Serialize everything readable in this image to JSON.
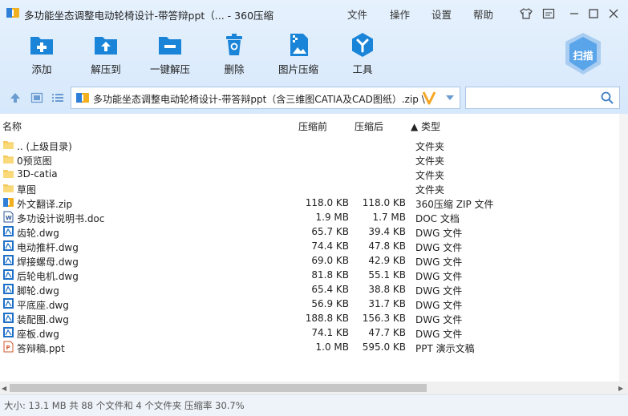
{
  "window": {
    "title": "多功能坐态调整电动轮椅设计-带答辩ppt（...  - 360压缩",
    "menu": [
      "文件",
      "操作",
      "设置",
      "帮助"
    ]
  },
  "toolbar": {
    "add": "添加",
    "extract": "解压到",
    "one_click": "一键解压",
    "delete": "删除",
    "image_compress": "图片压缩",
    "tools": "工具",
    "scan": "扫描"
  },
  "address": {
    "path": "多功能坐态调整电动轮椅设计-带答辩ppt（含三维图CATIA及CAD图纸）.zip \\",
    "search_placeholder": ""
  },
  "columns": {
    "name": "名称",
    "size": "压缩前",
    "packed": "压缩后",
    "type": "▲ 类型"
  },
  "files": [
    {
      "name": ".. (上级目录)",
      "size": "",
      "packed": "",
      "type": "文件夹",
      "icon": "folder-icon"
    },
    {
      "name": "0预览图",
      "size": "",
      "packed": "",
      "type": "文件夹",
      "icon": "folder-icon"
    },
    {
      "name": "3D-catia",
      "size": "",
      "packed": "",
      "type": "文件夹",
      "icon": "folder-icon"
    },
    {
      "name": "草图",
      "size": "",
      "packed": "",
      "type": "文件夹",
      "icon": "folder-icon"
    },
    {
      "name": "外文翻译.zip",
      "size": "118.0 KB",
      "packed": "118.0 KB",
      "type": "360压缩 ZIP 文件",
      "icon": "zip-icon"
    },
    {
      "name": "多功设计说明书.doc",
      "size": "1.9 MB",
      "packed": "1.7 MB",
      "type": "DOC 文档",
      "icon": "doc-icon"
    },
    {
      "name": "齿轮.dwg",
      "size": "65.7 KB",
      "packed": "39.4 KB",
      "type": "DWG 文件",
      "icon": "dwg-icon"
    },
    {
      "name": "电动推杆.dwg",
      "size": "74.4 KB",
      "packed": "47.8 KB",
      "type": "DWG 文件",
      "icon": "dwg-icon"
    },
    {
      "name": "焊接螺母.dwg",
      "size": "69.0 KB",
      "packed": "42.9 KB",
      "type": "DWG 文件",
      "icon": "dwg-icon"
    },
    {
      "name": "后轮电机.dwg",
      "size": "81.8 KB",
      "packed": "55.1 KB",
      "type": "DWG 文件",
      "icon": "dwg-icon"
    },
    {
      "name": "脚轮.dwg",
      "size": "65.4 KB",
      "packed": "38.8 KB",
      "type": "DWG 文件",
      "icon": "dwg-icon"
    },
    {
      "name": "平底座.dwg",
      "size": "56.9 KB",
      "packed": "31.7 KB",
      "type": "DWG 文件",
      "icon": "dwg-icon"
    },
    {
      "name": "装配图.dwg",
      "size": "188.8 KB",
      "packed": "156.3 KB",
      "type": "DWG 文件",
      "icon": "dwg-icon"
    },
    {
      "name": "座板.dwg",
      "size": "74.1 KB",
      "packed": "47.7 KB",
      "type": "DWG 文件",
      "icon": "dwg-icon"
    },
    {
      "name": "答辩稿.ppt",
      "size": "1.0 MB",
      "packed": "595.0 KB",
      "type": "PPT 演示文稿",
      "icon": "ppt-icon"
    }
  ],
  "status": "大小: 13.1 MB 共 88 个文件和 4 个文件夹 压缩率 30.7%"
}
